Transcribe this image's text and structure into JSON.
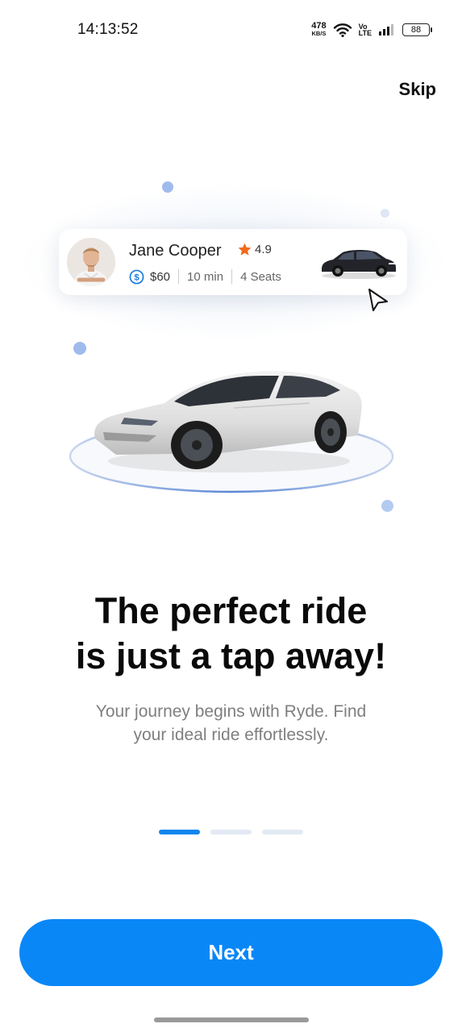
{
  "status_bar": {
    "time": "14:13:52",
    "net_speed_value": "478",
    "net_speed_unit": "KB/S",
    "volte_top": "Vo",
    "volte_bottom": "LTE",
    "battery": "88"
  },
  "header": {
    "skip_label": "Skip"
  },
  "ride_card": {
    "driver_name": "Jane Cooper",
    "rating": "4.9",
    "price": "$60",
    "duration": "10 min",
    "seats": "4 Seats"
  },
  "onboarding": {
    "title_line1": "The perfect ride",
    "title_line2": "is just a tap away!",
    "subtitle_line1": "Your journey begins with Ryde. Find",
    "subtitle_line2": "your ideal ride effortlessly.",
    "current_page": 1,
    "total_pages": 3
  },
  "footer": {
    "next_label": "Next"
  },
  "colors": {
    "accent": "#0a87f7",
    "star": "#f26a1b",
    "dot": "#9fbbee",
    "pager_inactive": "#e2e9f3"
  },
  "icons": [
    "wifi-icon",
    "signal-icon",
    "battery-icon",
    "star-icon",
    "dollar-icon",
    "cursor-icon"
  ]
}
